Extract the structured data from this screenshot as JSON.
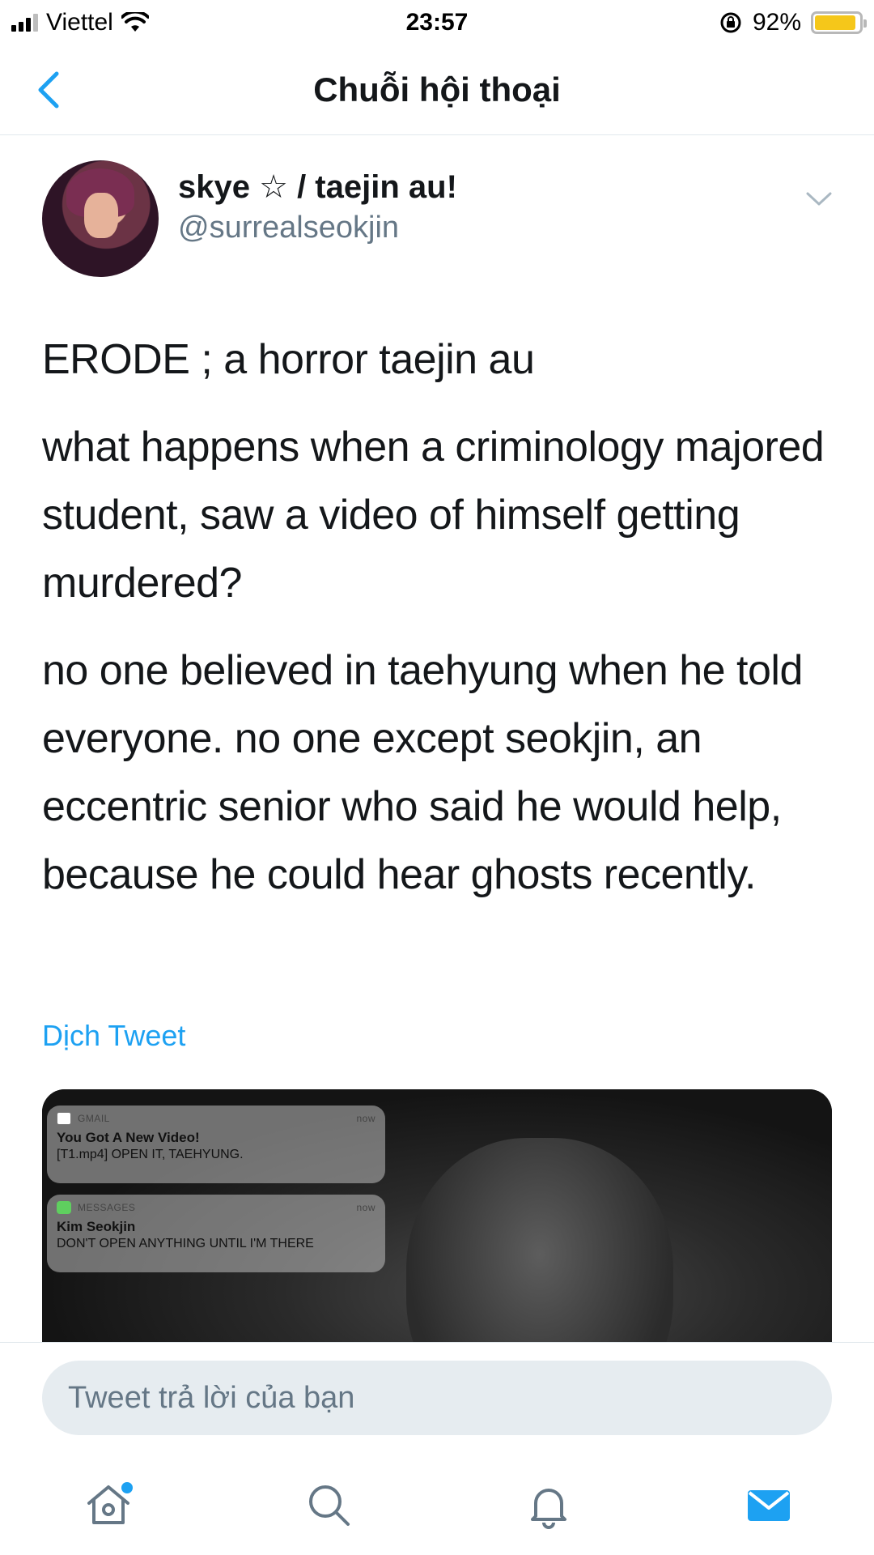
{
  "status_bar": {
    "carrier": "Viettel",
    "time": "23:57",
    "battery_percent": "92%",
    "battery_level": 0.92,
    "icons": [
      "signal-icon",
      "wifi-icon",
      "rotation-lock-icon",
      "battery-icon"
    ]
  },
  "nav": {
    "title": "Chuỗi hội thoại",
    "back_icon": "chevron-left-icon"
  },
  "tweet": {
    "author_name": "skye ☆ / taejin au!",
    "author_handle": "@surrealseokjin",
    "paragraphs": [
      "ERODE ; a horror taejin au",
      "what happens when a criminology majored student, saw a video of himself getting murdered?",
      "no one believed in taehyung when he told everyone. no one except seokjin, an eccentric senior who said he would help, because he could hear ghosts recently."
    ],
    "translate_label": "Dịch Tweet",
    "media": {
      "notifications": [
        {
          "app": "GMAIL",
          "time": "now",
          "title": "You Got A New Video!",
          "body": "[T1.mp4] OPEN IT, TAEHYUNG."
        },
        {
          "app": "MESSAGES",
          "time": "now",
          "title": "Kim Seokjin",
          "body": "DON'T OPEN ANYTHING UNTIL I'M THERE"
        }
      ]
    }
  },
  "reply": {
    "placeholder": "Tweet trả lời của bạn"
  },
  "tabbar": {
    "items": [
      "home-icon",
      "search-icon",
      "notifications-icon",
      "messages-icon"
    ],
    "accent": "#1da1f2"
  }
}
